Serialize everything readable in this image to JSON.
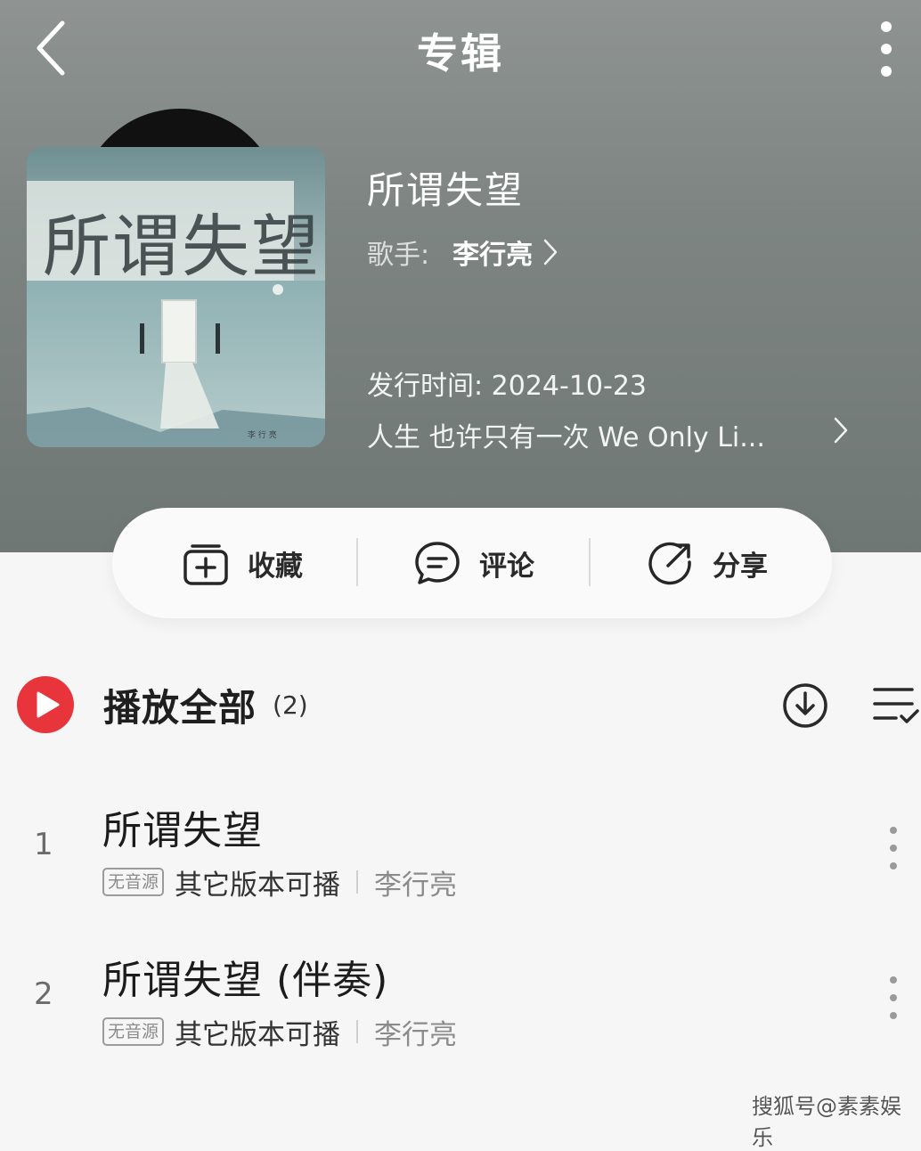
{
  "topbar": {
    "title": "专辑",
    "back_icon": "chevron-left-icon",
    "more_icon": "vertical-dots-icon"
  },
  "album": {
    "cover_text": "所谓失望",
    "cover_credit": "李 行 亮",
    "title": "所谓失望",
    "artist_label": "歌手:",
    "artist_name": "李行亮",
    "release_label": "发行时间:",
    "release_date": "2024-10-23",
    "description": "人生 也许只有一次 We Only Li..."
  },
  "actions": [
    {
      "label": "收藏",
      "icon": "add-to-collection-icon"
    },
    {
      "label": "评论",
      "icon": "comment-bubble-icon"
    },
    {
      "label": "分享",
      "icon": "share-arrow-icon"
    }
  ],
  "playlist": {
    "play_all_label": "播放全部",
    "count": "(2)",
    "download_icon": "download-icon",
    "multiselect_icon": "multi-select-icon"
  },
  "songs": [
    {
      "index": "1",
      "title": "所谓失望",
      "badge": "无音源",
      "note": "其它版本可播",
      "artist": "李行亮"
    },
    {
      "index": "2",
      "title": "所谓失望 (伴奏)",
      "badge": "无音源",
      "note": "其它版本可播",
      "artist": "李行亮"
    }
  ],
  "watermark": "搜狐号@素素娱乐",
  "colors": {
    "header_bg": "#7d8482",
    "play_red": "#e8353b",
    "card_bg": "#fafafb",
    "page_bg": "#f6f6f7"
  }
}
